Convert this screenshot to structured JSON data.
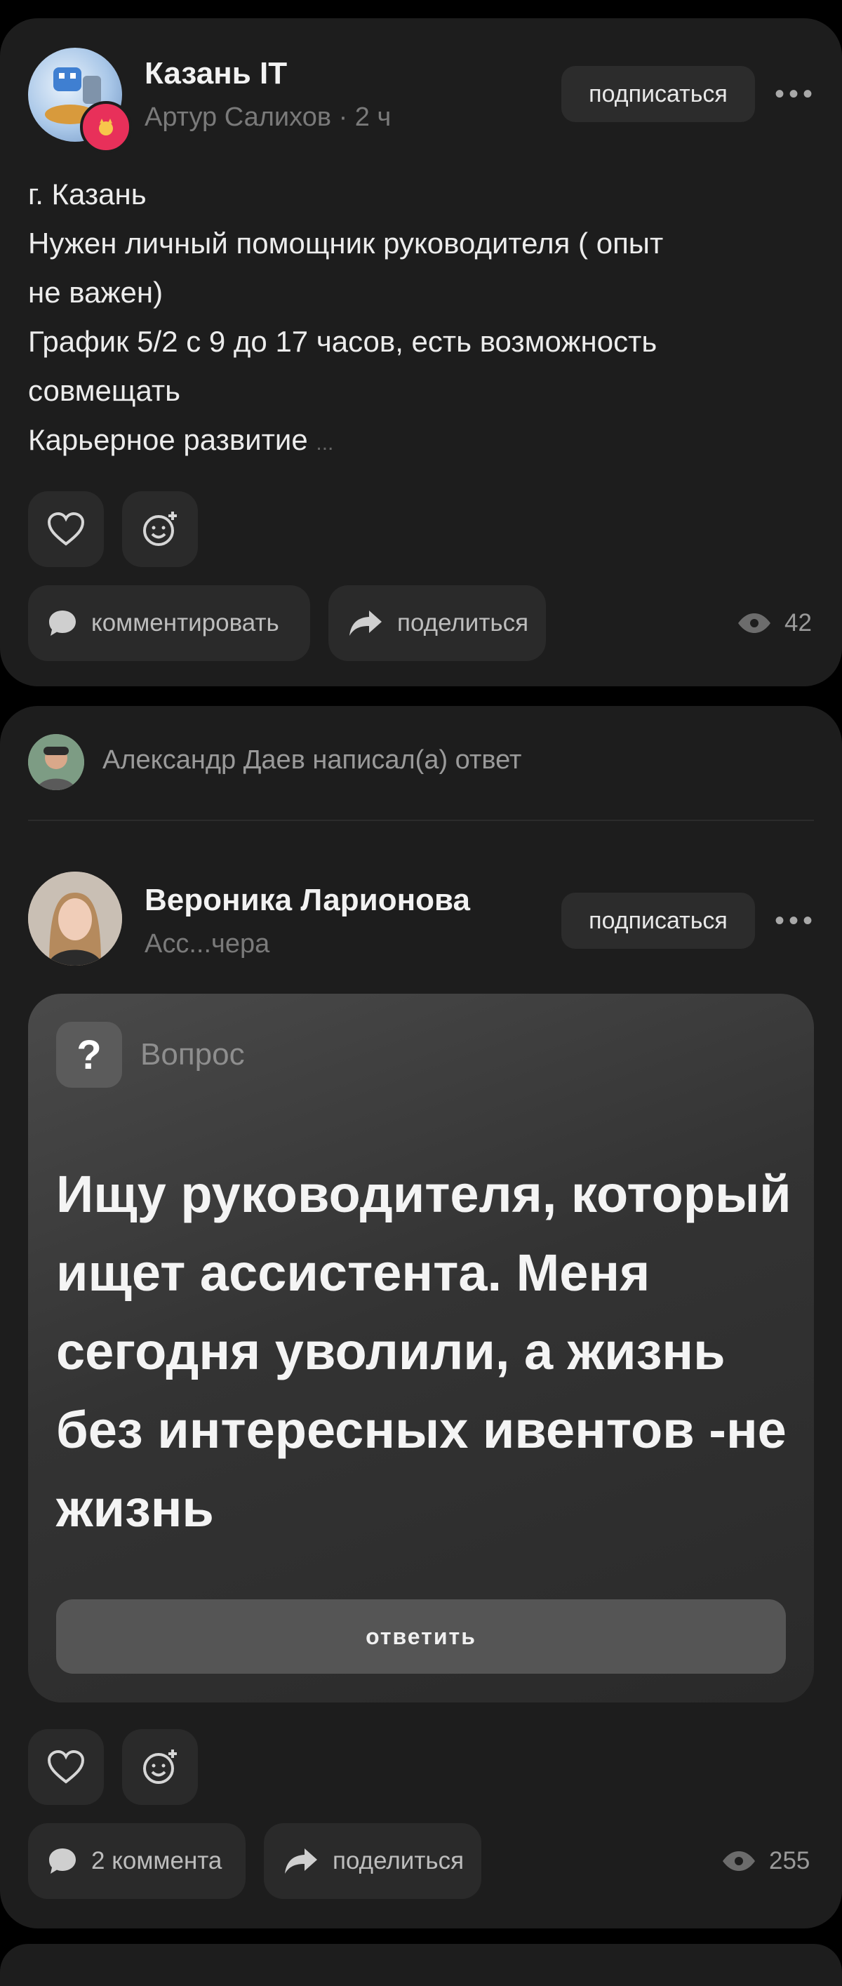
{
  "post1": {
    "title": "Казань IT",
    "subtitle": "Артур Салихов · 2 ч",
    "subscribe_label": "подписаться",
    "body_lines": [
      "г. Казань",
      "Нужен личный помощник руководителя ( опыт",
      "не важен)",
      "График 5/2 с 9 до 17 часов, есть возможность",
      "совмещать",
      "Карьерное развитие"
    ],
    "ellipsis": "...",
    "comment_label": "комментировать",
    "share_label": "поделиться",
    "views": "42"
  },
  "post2": {
    "reply_notice": "Александр Даев написал(а) ответ",
    "title": "Вероника Ларионова",
    "subtitle": "Асс...чера",
    "subscribe_label": "подписаться",
    "question_label": "Вопрос",
    "question_mark": "?",
    "question_text": "Ищу руководителя, который ищет ассистента. Меня сегодня уволили, а жизнь без интересных ивентов -не жизнь",
    "reply_label": "ответить",
    "comment_label": "2 коммента",
    "share_label": "поделиться",
    "views": "255"
  },
  "icons": {
    "like": "heart-icon",
    "reaction": "add-reaction-icon",
    "comment": "comment-bubble-icon",
    "share": "share-arrow-icon",
    "views": "eye-icon",
    "more": "more-dots-icon"
  },
  "colors": {
    "background": "#000000",
    "card": "#1d1d1d",
    "button": "#2a2a2a",
    "badge_red": "#e8305a"
  }
}
